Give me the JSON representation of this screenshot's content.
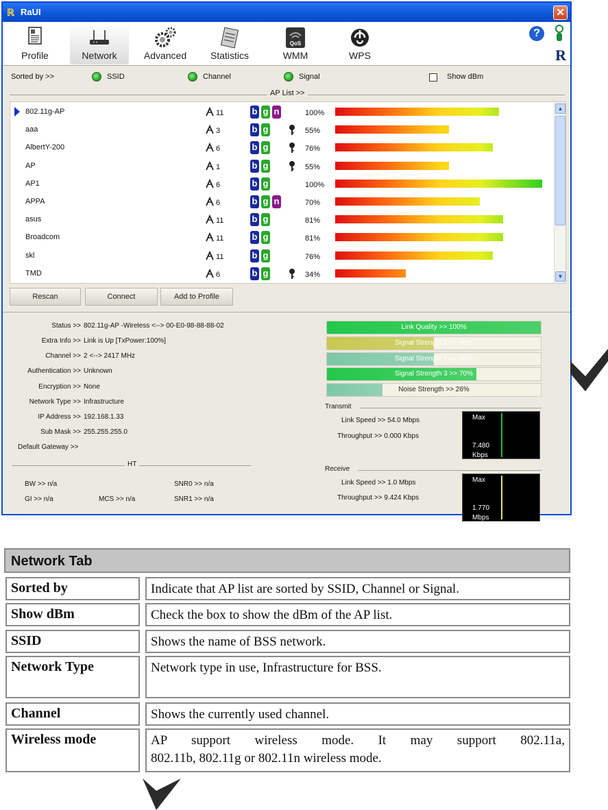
{
  "window": {
    "title": "RaUI",
    "close": "✕",
    "logo": "R"
  },
  "toolbar": {
    "tabs": [
      {
        "label": "Profile"
      },
      {
        "label": "Network"
      },
      {
        "label": "Advanced"
      },
      {
        "label": "Statistics"
      },
      {
        "label": "WMM"
      },
      {
        "label": "WPS"
      }
    ],
    "help": "?",
    "wmm_badge": "QoS"
  },
  "sort": {
    "label": "Sorted by >>",
    "ssid": "SSID",
    "channel": "Channel",
    "signal": "Signal",
    "show_dbm": "Show dBm"
  },
  "ap_list": {
    "label": "AP List >>",
    "rows": [
      {
        "ssid": "802.11g-AP",
        "channel": "11",
        "modes": [
          "b",
          "g",
          "n"
        ],
        "secure": false,
        "signal": "100%",
        "strength": 0.79
      },
      {
        "ssid": "aaa",
        "channel": "3",
        "modes": [
          "b",
          "g"
        ],
        "secure": true,
        "signal": "55%",
        "strength": 0.55
      },
      {
        "ssid": "AlbertY-200",
        "channel": "6",
        "modes": [
          "b",
          "g"
        ],
        "secure": true,
        "signal": "76%",
        "strength": 0.76
      },
      {
        "ssid": "AP",
        "channel": "1",
        "modes": [
          "b",
          "g"
        ],
        "secure": true,
        "signal": "55%",
        "strength": 0.55
      },
      {
        "ssid": "AP1",
        "channel": "6",
        "modes": [
          "b",
          "g"
        ],
        "secure": false,
        "signal": "100%",
        "strength": 1.0
      },
      {
        "ssid": "APPA",
        "channel": "6",
        "modes": [
          "b",
          "g",
          "n"
        ],
        "secure": false,
        "signal": "70%",
        "strength": 0.7
      },
      {
        "ssid": "asus",
        "channel": "11",
        "modes": [
          "b",
          "g"
        ],
        "secure": false,
        "signal": "81%",
        "strength": 0.81
      },
      {
        "ssid": "Broadcom",
        "channel": "11",
        "modes": [
          "b",
          "g"
        ],
        "secure": false,
        "signal": "81%",
        "strength": 0.81
      },
      {
        "ssid": "skl",
        "channel": "11",
        "modes": [
          "b",
          "g"
        ],
        "secure": false,
        "signal": "76%",
        "strength": 0.76
      },
      {
        "ssid": "TMD",
        "channel": "6",
        "modes": [
          "b",
          "g"
        ],
        "secure": true,
        "signal": "34%",
        "strength": 0.34
      }
    ]
  },
  "buttons": {
    "rescan": "Rescan",
    "connect": "Connect",
    "add_profile": "Add to Profile"
  },
  "status": {
    "status_k": "Status >>",
    "status_v": "802.11g-AP -Wireless  <--> 00-E0-98-88-88-02",
    "extra_k": "Extra Info >>",
    "extra_v": "Link is Up [TxPower:100%]",
    "channel_k": "Channel >>",
    "channel_v": "2 <--> 2417 MHz",
    "auth_k": "Authentication >>",
    "auth_v": "Unknown",
    "enc_k": "Encryption >>",
    "enc_v": "None",
    "nettype_k": "Network Type >>",
    "nettype_v": "Infrastructure",
    "ip_k": "IP Address >>",
    "ip_v": "192.168.1.33",
    "mask_k": "Sub Mask >>",
    "mask_v": "255.255.255.0",
    "gw_k": "Default Gateway >>",
    "ht_label": "HT",
    "bw": "BW >> n/a",
    "gi": "GI >> n/a",
    "mcs": "MCS >> n/a",
    "snr0": "SNR0 >> n/a",
    "snr1": "SNR1 >> n/a"
  },
  "quality": [
    {
      "text": "Link Quality >> 100%",
      "level": 1.0,
      "color": "#22c84a"
    },
    {
      "text": "Signal Strength 1 >> 50%",
      "level": 0.5,
      "color": "#c8c850"
    },
    {
      "text": "Signal Strength 2 >> 50%",
      "level": 0.5,
      "color": "#7cc8a8"
    },
    {
      "text": "Signal Strength 3 >> 70%",
      "level": 0.7,
      "color": "#22c84a"
    },
    {
      "text": "Noise Strength >> 26%",
      "level": 0.26,
      "color": "#7cc8a8"
    }
  ],
  "transmit": {
    "label": "Transmit",
    "link_speed": "Link Speed >>  54.0 Mbps",
    "throughput": "Throughput >> 0.000 Kbps",
    "max": "Max",
    "value": "7.480",
    "unit": "Kbps",
    "line_color": "#20c040"
  },
  "receive": {
    "label": "Receive",
    "link_speed": "Link Speed >>  1.0 Mbps",
    "throughput": "Throughput >> 9.424 Kbps",
    "max": "Max",
    "value": "1.770",
    "unit": "Mbps",
    "line_color": "#e8e060"
  },
  "doc": {
    "header": "Network Tab",
    "rows": [
      {
        "k": "Sorted by",
        "v": "Indicate that AP list are sorted by SSID, Channel or Signal."
      },
      {
        "k": "Show dBm",
        "v": "Check the box to show the dBm of the AP list."
      },
      {
        "k": "SSID",
        "v": "Shows the name of BSS network."
      },
      {
        "k": "Network Type",
        "v": "Network  type  in  use,  Infrastructure  for  BSS."
      },
      {
        "k": "Channel",
        "v": "Shows the currently used channel."
      },
      {
        "k": "Wireless mode",
        "v1": "AP  support  wireless  mode.  It  may  support  802.11a,",
        "v2": "802.11b, 802.11g or 802.11n wireless mode."
      }
    ]
  }
}
